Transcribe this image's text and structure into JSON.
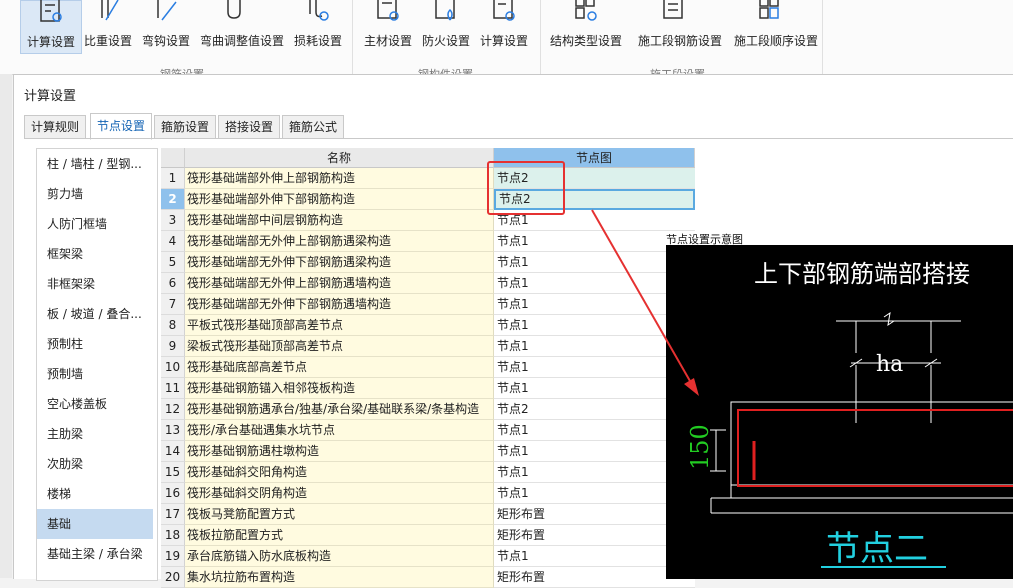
{
  "ribbon": {
    "buttons": [
      {
        "label": "计算设置",
        "icon": "calc-settings-icon",
        "selected": true
      },
      {
        "label": "比重设置",
        "icon": "weight-ratio-icon"
      },
      {
        "label": "弯钩设置",
        "icon": "hook-settings-icon"
      },
      {
        "label": "弯曲调整值设置",
        "icon": "bend-adjust-icon"
      },
      {
        "label": "损耗设置",
        "icon": "loss-settings-icon"
      },
      {
        "label": "主材设置",
        "icon": "main-material-icon"
      },
      {
        "label": "防火设置",
        "icon": "fireproof-icon"
      },
      {
        "label": "计算设置",
        "icon": "calc-settings-icon"
      },
      {
        "label": "结构类型设置",
        "icon": "structure-type-icon"
      },
      {
        "label": "施工段钢筋设置",
        "icon": "segment-rebar-icon"
      },
      {
        "label": "施工段顺序设置",
        "icon": "segment-order-icon"
      }
    ],
    "group_labels": [
      "钢筋设置",
      "钢构件设置",
      "施工段设置"
    ]
  },
  "dialog": {
    "title": "计算设置",
    "tabs": [
      "计算规则",
      "节点设置",
      "箍筋设置",
      "搭接设置",
      "箍筋公式"
    ],
    "active_tab": 1
  },
  "categories": [
    "柱 / 墙柱 / 型钢...",
    "剪力墙",
    "人防门框墙",
    "框架梁",
    "非框架梁",
    "板 / 坡道 / 叠合...",
    "预制柱",
    "预制墙",
    "空心楼盖板",
    "主肋梁",
    "次肋梁",
    "楼梯",
    "基础",
    "基础主梁 / 承台梁"
  ],
  "selected_category": 12,
  "grid": {
    "headers": {
      "name": "名称",
      "node": "节点图"
    },
    "rows": [
      {
        "num": "1",
        "name": "筏形基础端部外伸上部钢筋构造",
        "node": "节点2"
      },
      {
        "num": "2",
        "name": "筏形基础端部外伸下部钢筋构造",
        "node": "节点2"
      },
      {
        "num": "3",
        "name": "筏形基础端部中间层钢筋构造",
        "node": "节点1"
      },
      {
        "num": "4",
        "name": "筏形基础端部无外伸上部钢筋遇梁构造",
        "node": "节点1"
      },
      {
        "num": "5",
        "name": "筏形基础端部无外伸下部钢筋遇梁构造",
        "node": "节点1"
      },
      {
        "num": "6",
        "name": "筏形基础端部无外伸上部钢筋遇墙构造",
        "node": "节点1"
      },
      {
        "num": "7",
        "name": "筏形基础端部无外伸下部钢筋遇墙构造",
        "node": "节点1"
      },
      {
        "num": "8",
        "name": "平板式筏形基础顶部高差节点",
        "node": "节点1"
      },
      {
        "num": "9",
        "name": "梁板式筏形基础顶部高差节点",
        "node": "节点1"
      },
      {
        "num": "10",
        "name": "筏形基础底部高差节点",
        "node": "节点1"
      },
      {
        "num": "11",
        "name": "筏形基础钢筋锚入相邻筏板构造",
        "node": "节点1"
      },
      {
        "num": "12",
        "name": "筏形基础钢筋遇承台/独基/承台梁/基础联系梁/条基构造",
        "node": "节点2"
      },
      {
        "num": "13",
        "name": "筏形/承台基础遇集水坑节点",
        "node": "节点1"
      },
      {
        "num": "14",
        "name": "筏形基础钢筋遇柱墩构造",
        "node": "节点1"
      },
      {
        "num": "15",
        "name": "筏形基础斜交阳角构造",
        "node": "节点1"
      },
      {
        "num": "16",
        "name": "筏形基础斜交阴角构造",
        "node": "节点1"
      },
      {
        "num": "17",
        "name": "筏板马凳筋配置方式",
        "node": "矩形布置"
      },
      {
        "num": "18",
        "name": "筏板拉筋配置方式",
        "node": "矩形布置"
      },
      {
        "num": "19",
        "name": "承台底筋锚入防水底板构造",
        "node": "节点1"
      },
      {
        "num": "20",
        "name": "集水坑拉筋布置构造",
        "node": "矩形布置"
      }
    ],
    "selected_row": 1
  },
  "preview": {
    "title": "节点设置示意图",
    "heading": "上下部钢筋端部搭接",
    "dim_ha": "ha",
    "dim_150": "150",
    "caption": "节点二",
    "colors": {
      "bg": "#000000",
      "heading": "#ffffff",
      "dim": "#ffffff",
      "dim150": "#22cc22",
      "rebar": "#e02020",
      "caption": "#22d0e0"
    }
  },
  "annotation_color": "#e53131"
}
